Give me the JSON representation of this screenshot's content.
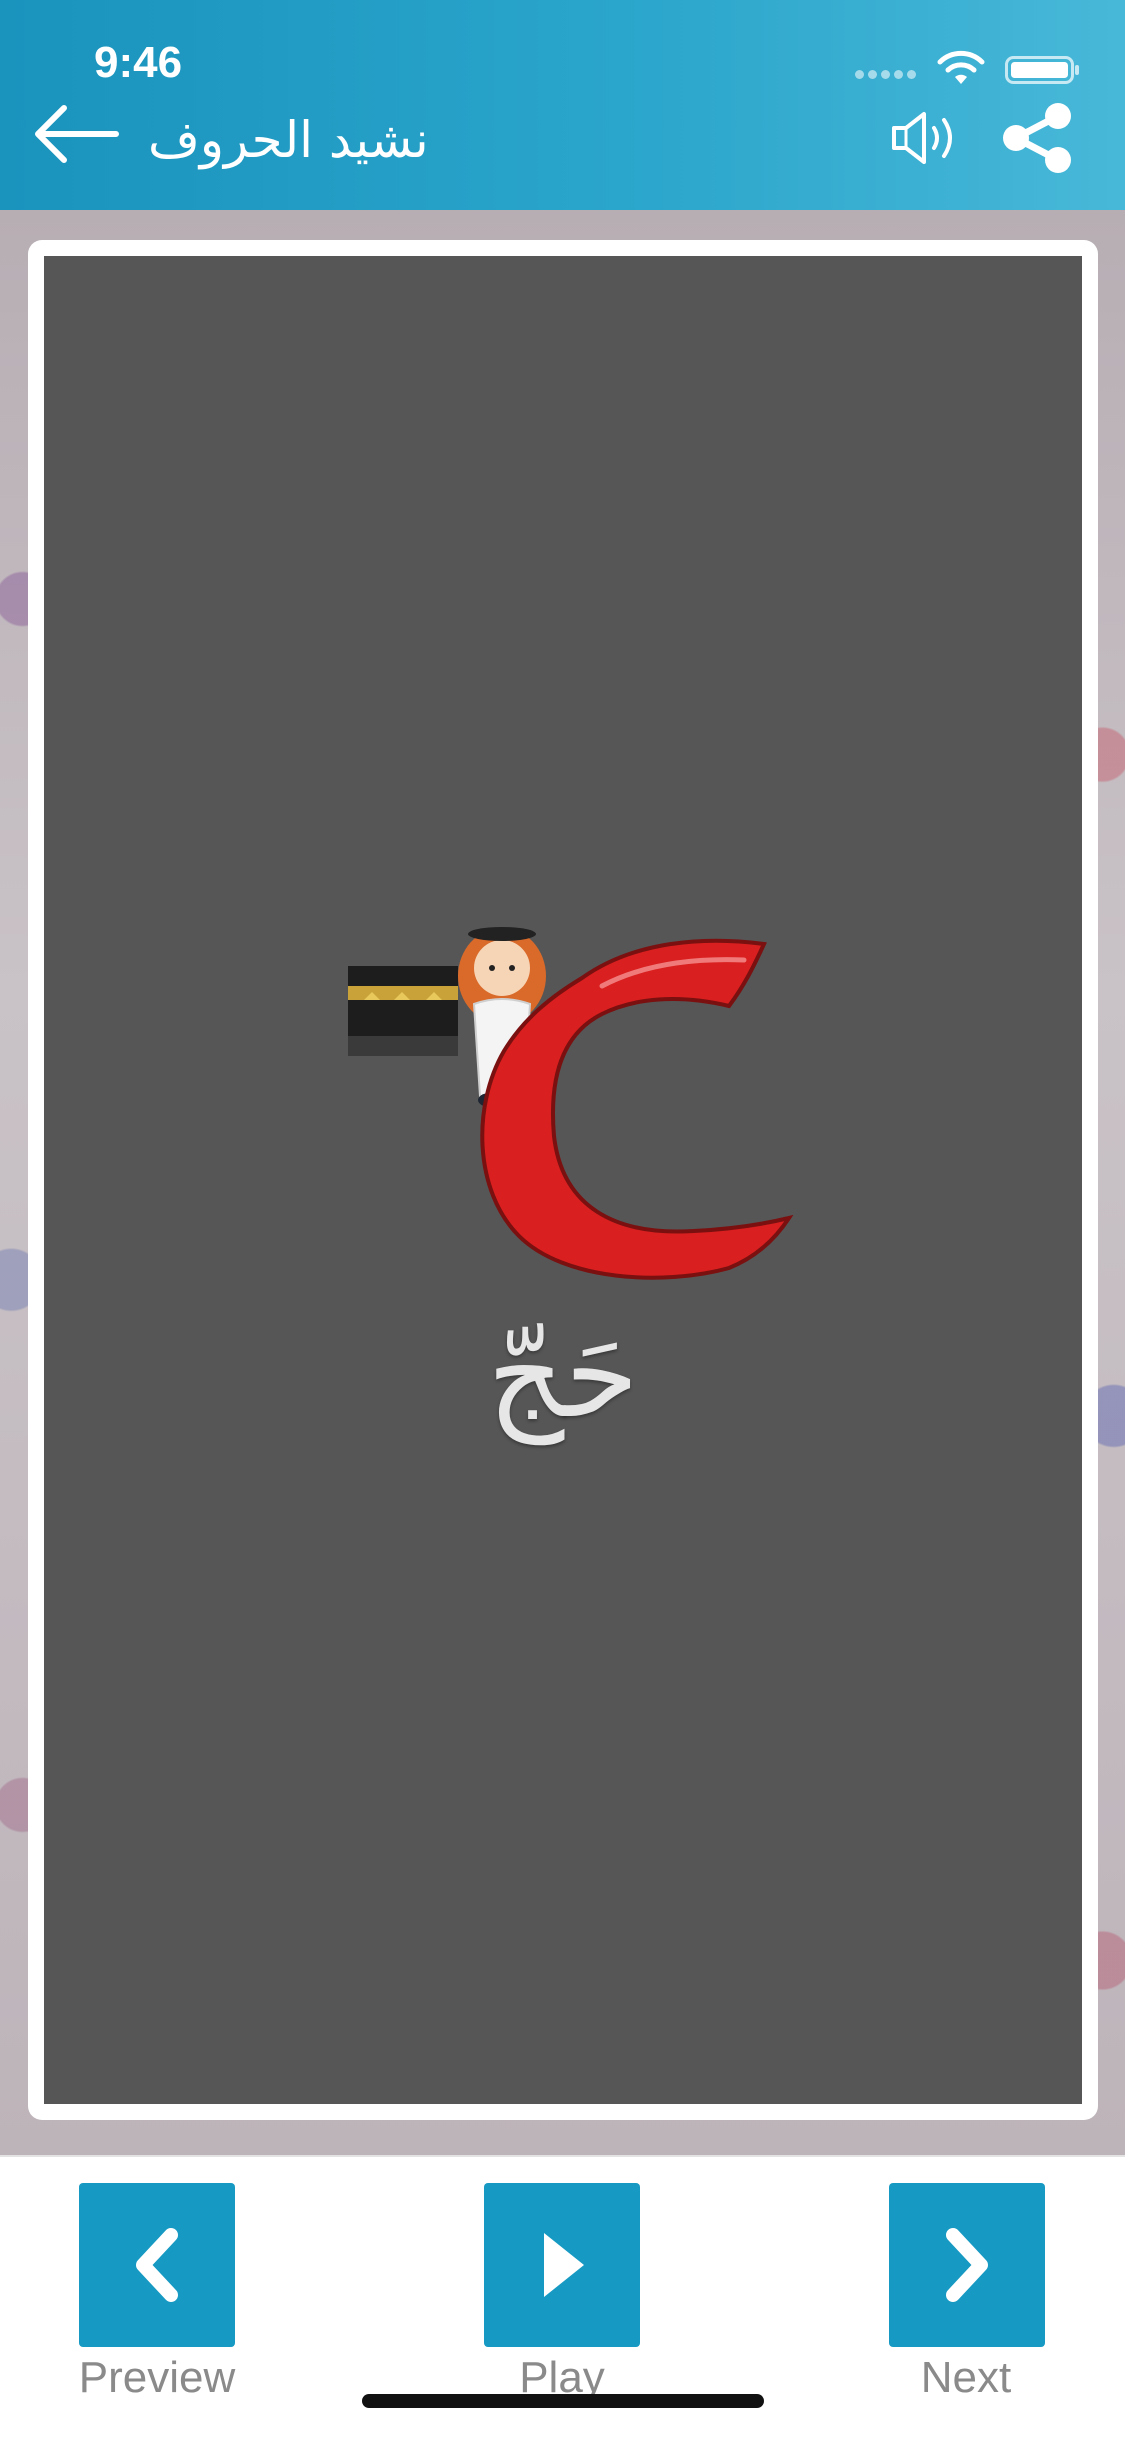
{
  "status_bar": {
    "time": "9:46"
  },
  "header": {
    "title": "نشيد الحروف",
    "icons": [
      "back-arrow-icon",
      "speaker-icon",
      "share-icon"
    ]
  },
  "card": {
    "letter": "ح",
    "word": "حَجّ",
    "letter_color": "#d91f1f",
    "background_color": "#565656"
  },
  "bottom_nav": {
    "preview_label": "Preview",
    "play_label": "Play",
    "next_label": "Next",
    "button_color": "#1699c2"
  }
}
